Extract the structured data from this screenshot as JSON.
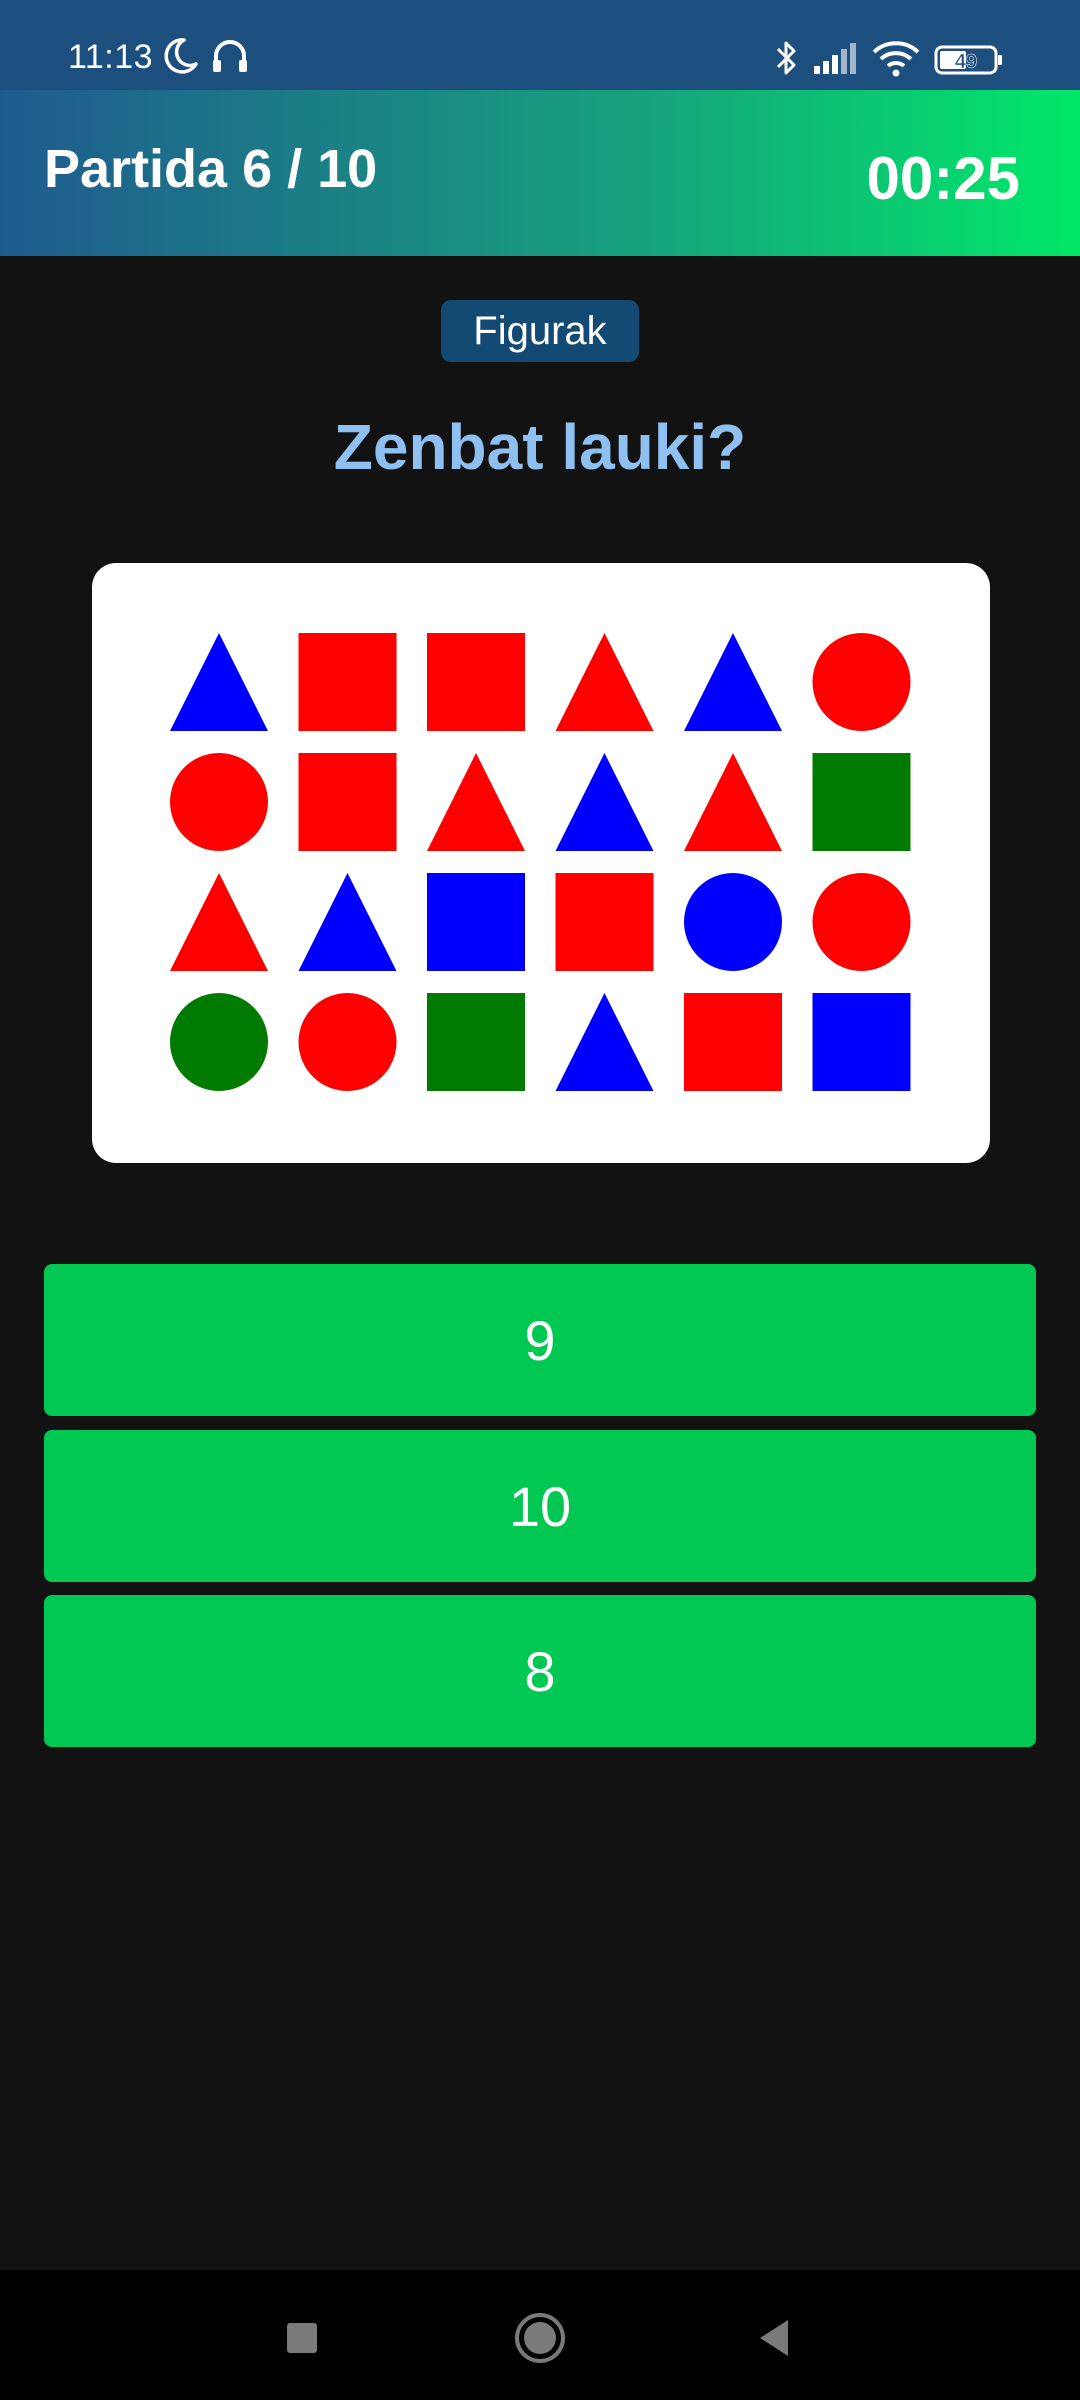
{
  "status_bar": {
    "time": "11:13",
    "battery": "49",
    "icons": [
      "moon-icon",
      "headphones-icon",
      "bluetooth-icon",
      "signal-icon",
      "wifi-icon",
      "battery-icon"
    ]
  },
  "header": {
    "round": "Partida 6 / 10",
    "timer": "00:25",
    "gradient": [
      "#1f5b8f",
      "#00e868"
    ]
  },
  "category": "Figurak",
  "question": "Zenbat lauki?",
  "figure": {
    "colors": {
      "red": "#ff0000",
      "blue": "#0000ff",
      "green": "#007a00"
    },
    "grid": [
      [
        {
          "shape": "triangle",
          "color": "blue"
        },
        {
          "shape": "square",
          "color": "red"
        },
        {
          "shape": "square",
          "color": "red"
        },
        {
          "shape": "triangle",
          "color": "red"
        },
        {
          "shape": "triangle",
          "color": "blue"
        },
        {
          "shape": "circle",
          "color": "red"
        }
      ],
      [
        {
          "shape": "circle",
          "color": "red"
        },
        {
          "shape": "square",
          "color": "red"
        },
        {
          "shape": "triangle",
          "color": "red"
        },
        {
          "shape": "triangle",
          "color": "blue"
        },
        {
          "shape": "triangle",
          "color": "red"
        },
        {
          "shape": "square",
          "color": "green"
        }
      ],
      [
        {
          "shape": "triangle",
          "color": "red"
        },
        {
          "shape": "triangle",
          "color": "blue"
        },
        {
          "shape": "square",
          "color": "blue"
        },
        {
          "shape": "square",
          "color": "red"
        },
        {
          "shape": "circle",
          "color": "blue"
        },
        {
          "shape": "circle",
          "color": "red"
        }
      ],
      [
        {
          "shape": "circle",
          "color": "green"
        },
        {
          "shape": "circle",
          "color": "red"
        },
        {
          "shape": "square",
          "color": "green"
        },
        {
          "shape": "triangle",
          "color": "blue"
        },
        {
          "shape": "square",
          "color": "red"
        },
        {
          "shape": "square",
          "color": "blue"
        }
      ]
    ]
  },
  "answers": [
    "9",
    "10",
    "8"
  ],
  "colors": {
    "background": "#121212",
    "answer": "#00c853",
    "question": "#8fc0f2",
    "badge": "#134a73"
  }
}
